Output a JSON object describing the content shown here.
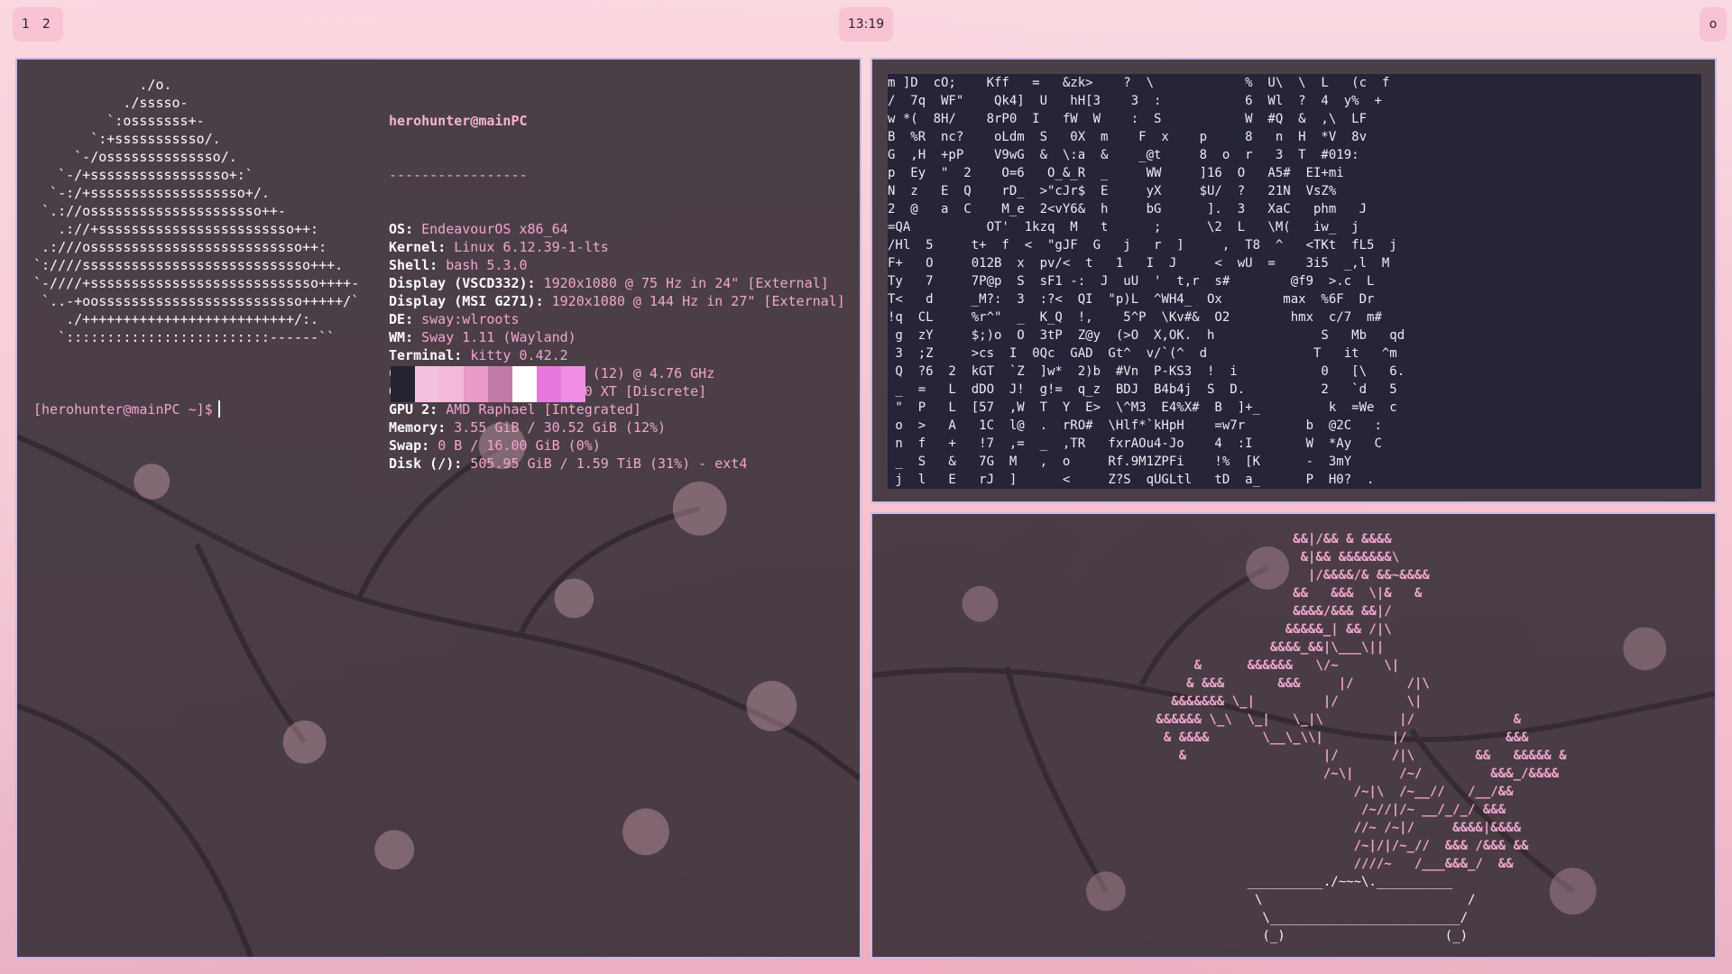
{
  "topbar": {
    "workspaces": [
      "1",
      "2"
    ],
    "clock": "13:19",
    "tray": "o"
  },
  "colors": {
    "accent": "#f0a6cf",
    "window_border": "#c9b9e8",
    "terminal_bg": "#322a32",
    "matrix_bg": "#252438",
    "bar_pill": "#f8c3d3"
  },
  "fastfetch": {
    "logo": [
      "             ./o.",
      "           ./sssso-",
      "         `:osssssss+-",
      "       `:+sssssssssso/.",
      "     `-/ossssssssssssso/.",
      "   `-/+sssssssssssssssso+:`",
      "  `-:/+sssssssssssssssssso+/.",
      " `.://osssssssssssssssssssso++-",
      "   .://+ssssssssssssssssssssssso++:",
      " .:///ossssssssssssssssssssssssso++:",
      "`:////ssssssssssssssssssssssssssso+++.",
      "`-////+ssssssssssssssssssssssssssso++++-",
      " `..-+oosssssssssssssssssssssssso+++++/`",
      "    ./++++++++++++++++++++++++++/:.",
      "   `:::::::::::::::::::::::::------``"
    ],
    "user": "herohunter",
    "host": "mainPC",
    "separator": "-----------------",
    "fields": [
      {
        "key": "OS",
        "value": "EndeavourOS x86_64"
      },
      {
        "key": "Kernel",
        "value": "Linux 6.12.39-1-lts"
      },
      {
        "key": "Shell",
        "value": "bash 5.3.0"
      },
      {
        "key": "Display (VSCD332)",
        "value": "1920x1080 @ 75 Hz in 24\" [External]"
      },
      {
        "key": "Display (MSI G271)",
        "value": "1920x1080 @ 144 Hz in 27\" [External]"
      },
      {
        "key": "DE",
        "value": "sway:wlroots"
      },
      {
        "key": "WM",
        "value": "Sway 1.11 (Wayland)"
      },
      {
        "key": "Terminal",
        "value": "kitty 0.42.2"
      },
      {
        "key": "CPU",
        "value": "AMD Ryzen 5 7600X3D (12) @ 4.76 GHz"
      },
      {
        "key": "GPU 1",
        "value": "AMD Radeon RX 7600 XT [Discrete]"
      },
      {
        "key": "GPU 2",
        "value": "AMD Raphael [Integrated]"
      },
      {
        "key": "Memory",
        "value": "3.55 GiB / 30.52 GiB (12%)"
      },
      {
        "key": "Swap",
        "value": "0 B / 16.00 GiB (0%)"
      },
      {
        "key": "Disk (/)",
        "value": "505.95 GiB / 1.59 TiB (31%) - ext4"
      }
    ],
    "swatches": [
      "#242331",
      "#f3c1dd",
      "#f4b9da",
      "#e89ac8",
      "#c27aa8",
      "#ffffff",
      "#e878dc",
      "#f08ee6"
    ],
    "prompt": "[herohunter@mainPC ~]$"
  },
  "matrix": {
    "lines": [
      "m ]D  cO;    Kff   =   &zk>    ?  \\            %  U\\  \\  L   (c  f",
      "/  7q  WF\"    Qk4]  U   hH[3    3  :           6  Wl  ?  4  y%  +",
      "w *(  8H/    8rP0  I   fW  W    :  S           W  #Q  &  ,\\  LF",
      "B  %R  nc?    oLdm  S   0X  m    F  x    p     8   n  H  *V  8v",
      "G  ,H  +pP    V9wG  &  \\:a  &    _@t     8  o  r   3  T  #019:",
      "p  Ey  \"  2    O=6   O_&_R  _     WW     ]16  O   A5#  EI+mi",
      "N  z   E  Q    rD_  >\"cJr$  E     yX     $U/  ?   21N  VsZ%",
      "2  @   a  C    M_e  2<vY6&  h     bG      ].  3   XaC   phm   J",
      "=QA          OT'  1kzq  M   t      ;      \\2  L   \\M(   iw_  j",
      "/Hl  5     t+  f  <  \"gJF  G   j   r  ]     ,  T8  ^   <TKt  fL5  j",
      "F+   O     012B  x  pv/<  t   1   I  J     <  wU  =    3i5  _,l  M",
      "Ty   7     7P@p  S  sF1 -:  J  uU  '  t,r  s#        @f9  >.c  L",
      "T<   d     _M?:  3  :?<  QI  \"p)L  ^WH4_  Ox        max  %6F  Dr",
      "!q  CL     %r^\"  _  K_Q  !,    5^P  \\Kv#&  O2        hmx  c/7  m#",
      " g  zY     $;)o  O  3tP  Z@y  (>O  X,OK.  h              S   Mb   qd",
      " 3  ;Z     >cs  I  0Qc  GAD  Gt^  v/`(^  d              T   it   ^m",
      " Q  ?6  2  kGT  `Z  ]w*  2)b  #Vn  P-KS3  !  i           0   [\\   6.",
      " _  =   L  dDO  J!  g!=  q_z  BDJ  B4b4j  S  D.          2   `d   5",
      " \"  P   L  [57  ,W  T  Y  E>  \\^M3  E4%X#  B  ]+_         k  =We  c",
      " o  >   A   1C  l@  .  rRO#  \\Hlf*`kHpH    =w7r        b  @2C   :",
      " n  f   +   !7  ,=  _  ,TR   fxrAOu4-Jo    4  :I       W  *Ay   C",
      " _  S   &   7G  M   ,  o     Rf.9M1ZPFi    !%  [K      -  3mY",
      " j  l   E   rJ  ]      <     Z?S  qUGLtl   tD  a_      P  H0?  ."
    ]
  },
  "bonsai": {
    "leaves": [
      "                          &&|/&& & &&&&",
      "                           &|&& &&&&&&&\\",
      "                            |/&&&&/& &&~&&&&",
      "                          &&   &&&  \\|&   &",
      "                          &&&&/&&& &&|/",
      "                         &&&&&_| && /|\\",
      "                       &&&&_&&|\\___\\||",
      "             &      &&&&&&   \\/~      \\|",
      "            & &&&       &&&     |/       /|\\",
      "          &&&&&&& \\_|         |/         \\|",
      "        &&&&&& \\_\\  \\_|   \\_|\\          |/             &",
      "         & &&&&       \\__\\_\\\\|         |/             &&&",
      "           &                  |/       /|\\        &&   &&&&& &",
      "                              /~\\|      /~/         &&&_/&&&&",
      "                                  /~|\\  /~__//   /__/&&",
      "                                   /~//|/~ __/_/_/ &&&",
      "                                  //~ /~|/     &&&&|&&&&",
      "                                  /~|/|/~_//  &&& /&&& &&",
      "                                  ////~   /___&&&_/  &&"
    ],
    "pot_top": "                    __________./~~~\\.__________",
    "pot_lines": [
      "                     \\                           /",
      "                      \\_________________________/",
      "                      (_)                     (_)"
    ]
  }
}
